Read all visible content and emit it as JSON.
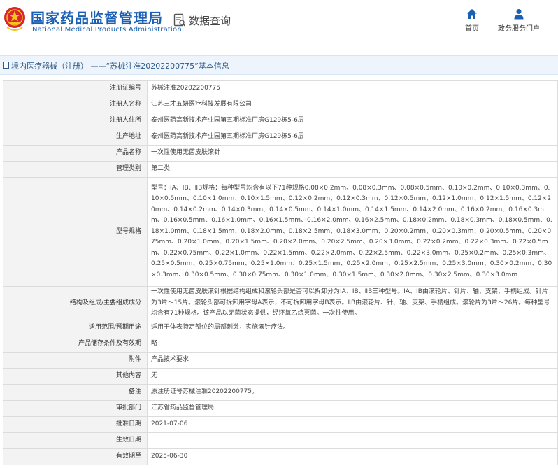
{
  "header": {
    "site_title": "国家药品监督管理局",
    "site_subtitle": "National Medical Products Administration",
    "data_query_label": "数据查询",
    "nav": [
      {
        "label": "首页",
        "icon": "home-icon"
      },
      {
        "label": "政务服务门户",
        "icon": "user-icon"
      }
    ]
  },
  "breadcrumb": {
    "text": "境内医疗器械（注册） ——“苏械注准20202200775”基本信息"
  },
  "details": [
    {
      "label": "注册证编号",
      "value": "苏械注准20202200775"
    },
    {
      "label": "注册人名称",
      "value": "江苏三才五妍医疗科技发展有限公司"
    },
    {
      "label": "注册人住所",
      "value": "泰州医药高新技术产业园第五期标准厂房G129栋5-6层"
    },
    {
      "label": "生产地址",
      "value": "泰州医药高新技术产业园第五期标准厂房G129栋5-6层"
    },
    {
      "label": "产品名称",
      "value": "一次性使用无菌皮肤滚针"
    },
    {
      "label": "管理类别",
      "value": "第二类"
    },
    {
      "label": "型号规格",
      "value": "型号：ⅠA、ⅠB、ⅡB规格：每种型号均含有以下71种规格0.08×0.2mm、0.08×0.3mm、0.08×0.5mm、0.10×0.2mm、0.10×0.3mm、0.10×0.5mm、0.10×1.0mm、0.10×1.5mm、0.12×0.2mm、0.12×0.3mm、0.12×0.5mm、0.12×1.0mm、0.12×1.5mm、0.12×2.0mm、0.14×0.2mm、0.14×0.3mm、0.14×0.5mm、0.14×1.0mm、0.14×1.5mm、0.14×2.0mm、0.16×0.2mm、0.16×0.3mm、0.16×0.5mm、0.16×1.0mm、0.16×1.5mm、0.16×2.0mm、0.16×2.5mm、0.18×0.2mm、0.18×0.3mm、0.18×0.5mm、0.18×1.0mm、0.18×1.5mm、0.18×2.0mm、0.18×2.5mm、0.18×3.0mm、0.20×0.2mm、0.20×0.3mm、0.20×0.5mm、0.20×0.75mm、0.20×1.0mm、0.20×1.5mm、0.20×2.0mm、0.20×2.5mm、0.20×3.0mm、0.22×0.2mm、0.22×0.3mm、0.22×0.5mm、0.22×0.75mm、0.22×1.0mm、0.22×1.5mm、0.22×2.0mm、0.22×2.5mm、0.22×3.0mm、0.25×0.2mm、0.25×0.3mm、0.25×0.5mm、0.25×0.75mm、0.25×1.0mm、0.25×1.5mm、0.25×2.0mm、0.25×2.5mm、0.25×3.0mm、0.30×0.2mm、0.30×0.3mm、0.30×0.5mm、0.30×0.75mm、0.30×1.0mm、0.30×1.5mm、0.30×2.0mm、0.30×2.5mm、0.30×3.0mm"
    },
    {
      "label": "结构及组成/主要组成成分",
      "value": "一次性使用无菌皮肤滚针根据结构组成和滚轮头部是否可以拆卸分为ⅠA、ⅠB、ⅡB三种型号。ⅠA、ⅠB由滚轮片、针片、轴、支架、手柄组成。针片为3片～15片。滚轮头部可拆卸用字母A表示，不可拆卸用字母B表示。ⅡB由滚轮片、针、轴、支架、手柄组成。滚轮片为3片～26片。每种型号均含有71种规格。该产品以无菌状态提供，经环氧乙烷灭菌。一次性使用。"
    },
    {
      "label": "适用范围/预期用途",
      "value": "适用于体表特定部位的局部刺激，实施滚针疗法。"
    },
    {
      "label": "产品储存条件及有效期",
      "value": "略"
    },
    {
      "label": "附件",
      "value": "产品技术要求"
    },
    {
      "label": "其他内容",
      "value": "无"
    },
    {
      "label": "备注",
      "value": "原注册证号苏械注准20202200775。"
    },
    {
      "label": "审批部门",
      "value": "江苏省药品监督管理局"
    },
    {
      "label": "批准日期",
      "value": "2021-07-06"
    },
    {
      "label": "生效日期",
      "value": ""
    },
    {
      "label": "有效期至",
      "value": "2025-06-30"
    }
  ]
}
